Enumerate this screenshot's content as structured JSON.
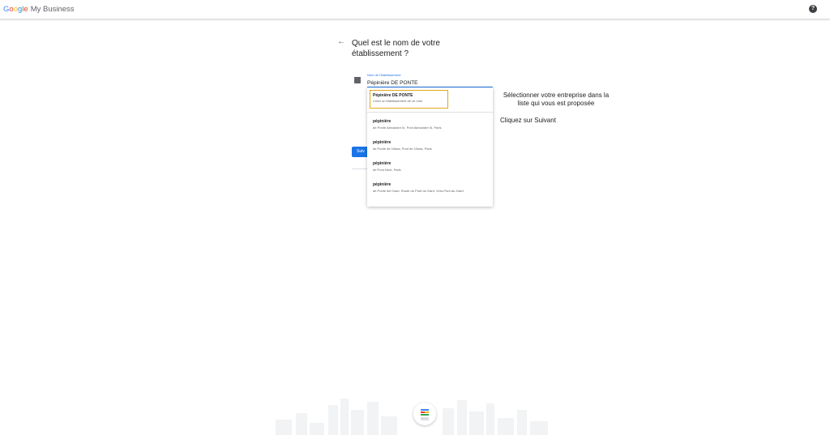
{
  "app": {
    "logo_google": [
      "G",
      "o",
      "o",
      "g",
      "l",
      "e"
    ],
    "product": "My Business"
  },
  "help_icon": "?",
  "back_icon": "←",
  "page": {
    "title": "Quel est le nom de votre établissement ?"
  },
  "field": {
    "label": "Nom de l'établissement",
    "value": "Pépinière DE PONTE"
  },
  "next_button": "Suiv",
  "dropdown": {
    "create": {
      "title": "Pépinière DE PONTE",
      "subtitle": "Créer un établissement de ce nom"
    },
    "suggestions": [
      {
        "title": "pépinière",
        "subtitle": "de Ponte Alexandre III, Pont Alexandre III, Paris"
      },
      {
        "title": "pépinière",
        "subtitle": "de Ponte de l'Alma, Pont de l'Alma, Paris"
      },
      {
        "title": "pépinière",
        "subtitle": "de Pont Neuf, Paris"
      },
      {
        "title": "pépinière",
        "subtitle": "de Ponte del Gard, Route du Pont du Gard, Vers-Pont-du-Gard"
      }
    ]
  },
  "annotations": {
    "select": "Sélectionner votre entreprise dans la liste qui vous est proposée",
    "next": "Cliquez sur Suivant"
  },
  "colors": {
    "accent": "#1a73e8",
    "highlight": "#e0a820"
  }
}
